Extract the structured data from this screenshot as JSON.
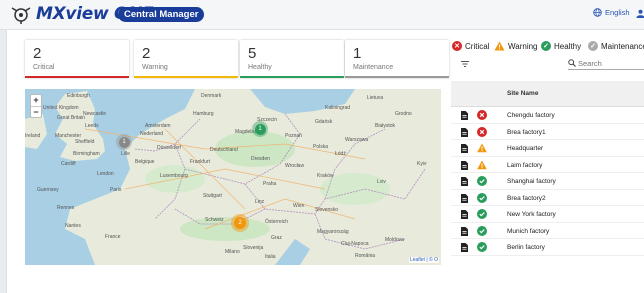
{
  "header": {
    "brand": "MXview ONE",
    "badge": "Central Manager",
    "language": "English"
  },
  "summary": [
    {
      "count": "2",
      "label": "Critical",
      "color": "#d62728"
    },
    {
      "count": "2",
      "label": "Warning",
      "color": "#f2b90c"
    },
    {
      "count": "5",
      "label": "Healthy",
      "color": "#2a9d5c"
    },
    {
      "count": "1",
      "label": "Maintenance",
      "color": "#999999"
    }
  ],
  "legend": {
    "critical": "Critical",
    "warning": "Warning",
    "healthy": "Healthy",
    "maintenance": "Maintenance"
  },
  "search": {
    "placeholder": "Search"
  },
  "table": {
    "header": "Site Name",
    "rows": [
      {
        "name": "Chengdu factory",
        "status": "critical"
      },
      {
        "name": "Brea factory1",
        "status": "critical"
      },
      {
        "name": "Headquarter",
        "status": "warning"
      },
      {
        "name": "Laim factory",
        "status": "warning"
      },
      {
        "name": "Shanghai factory",
        "status": "healthy"
      },
      {
        "name": "Brea factory2",
        "status": "healthy"
      },
      {
        "name": "New York factory",
        "status": "healthy"
      },
      {
        "name": "Munich factory",
        "status": "healthy"
      },
      {
        "name": "Berlin factory",
        "status": "healthy"
      }
    ]
  },
  "map": {
    "zoom_in": "+",
    "zoom_out": "−",
    "attribution": "Leaflet | © O",
    "clusters": [
      {
        "count": "1",
        "status": "maintenance"
      },
      {
        "count": "1",
        "status": "healthy"
      },
      {
        "count": "2",
        "status": "warning"
      }
    ],
    "labels": [
      "Denmark",
      "Edinburgh",
      "United Kingdom",
      "Great Britain",
      "Newcastle",
      "Ireland",
      "Leeds",
      "Manchester",
      "Sheffield",
      "Birmingham",
      "Cardiff",
      "London",
      "Hamburg",
      "Nederland",
      "Amsterdam",
      "Düsseldorf",
      "Deutschland",
      "Magdeburg",
      "Dresden",
      "Frankfurt",
      "Belgique",
      "Paris",
      "France",
      "Lille",
      "Luxembourg",
      "Stuttgart",
      "Guernsey",
      "Rennes",
      "Nantes",
      "Schweiz",
      "Milano",
      "Italia",
      "Österreich",
      "Linz",
      "Wien",
      "Graz",
      "Slovenija",
      "Magyarország",
      "Slovensko",
      "Praha",
      "Polska",
      "Wrocław",
      "Kraków",
      "Łódź",
      "Warszawa",
      "Poznań",
      "Szczecin",
      "Gdańsk",
      "Białystok",
      "Lietuva",
      "Kaliningrad",
      "Grodno",
      "Lviv",
      "Cluj-Napoca",
      "Moldova",
      "România",
      "Kyiv"
    ]
  }
}
